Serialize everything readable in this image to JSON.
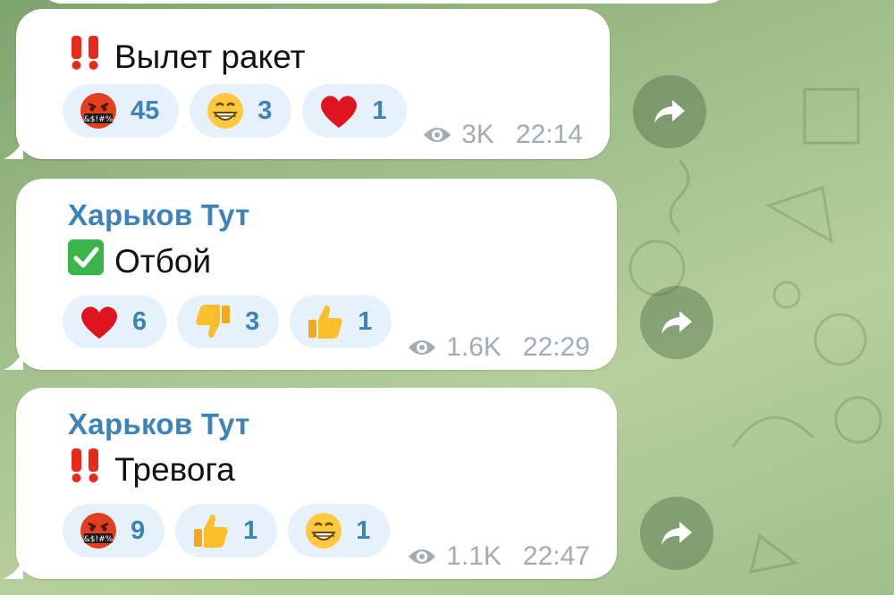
{
  "messages": [
    {
      "sender": "",
      "emoji": "‼️",
      "text": "Вылет ракет",
      "reactions": [
        {
          "icon": "swearing-face-icon",
          "count": "45"
        },
        {
          "icon": "grinning-face-icon",
          "count": "3"
        },
        {
          "icon": "red-heart-icon",
          "count": "1"
        }
      ],
      "views": "3K",
      "time": "22:14"
    },
    {
      "sender": "Харьков Тут",
      "emoji": "✅",
      "text": "Отбой",
      "reactions": [
        {
          "icon": "red-heart-icon",
          "count": "6"
        },
        {
          "icon": "thumbs-down-icon",
          "count": "3"
        },
        {
          "icon": "thumbs-up-icon",
          "count": "1"
        }
      ],
      "views": "1.6K",
      "time": "22:29"
    },
    {
      "sender": "Харьков Тут",
      "emoji": "‼️",
      "text": "Тревога",
      "reactions": [
        {
          "icon": "swearing-face-icon",
          "count": "9"
        },
        {
          "icon": "thumbs-up-icon",
          "count": "1"
        },
        {
          "icon": "grinning-face-icon",
          "count": "1"
        }
      ],
      "views": "1.1K",
      "time": "22:47"
    }
  ],
  "colors": {
    "accent": "#3d82ba",
    "reaction_bg": "#e5f1fb",
    "meta": "#a3acb4"
  }
}
